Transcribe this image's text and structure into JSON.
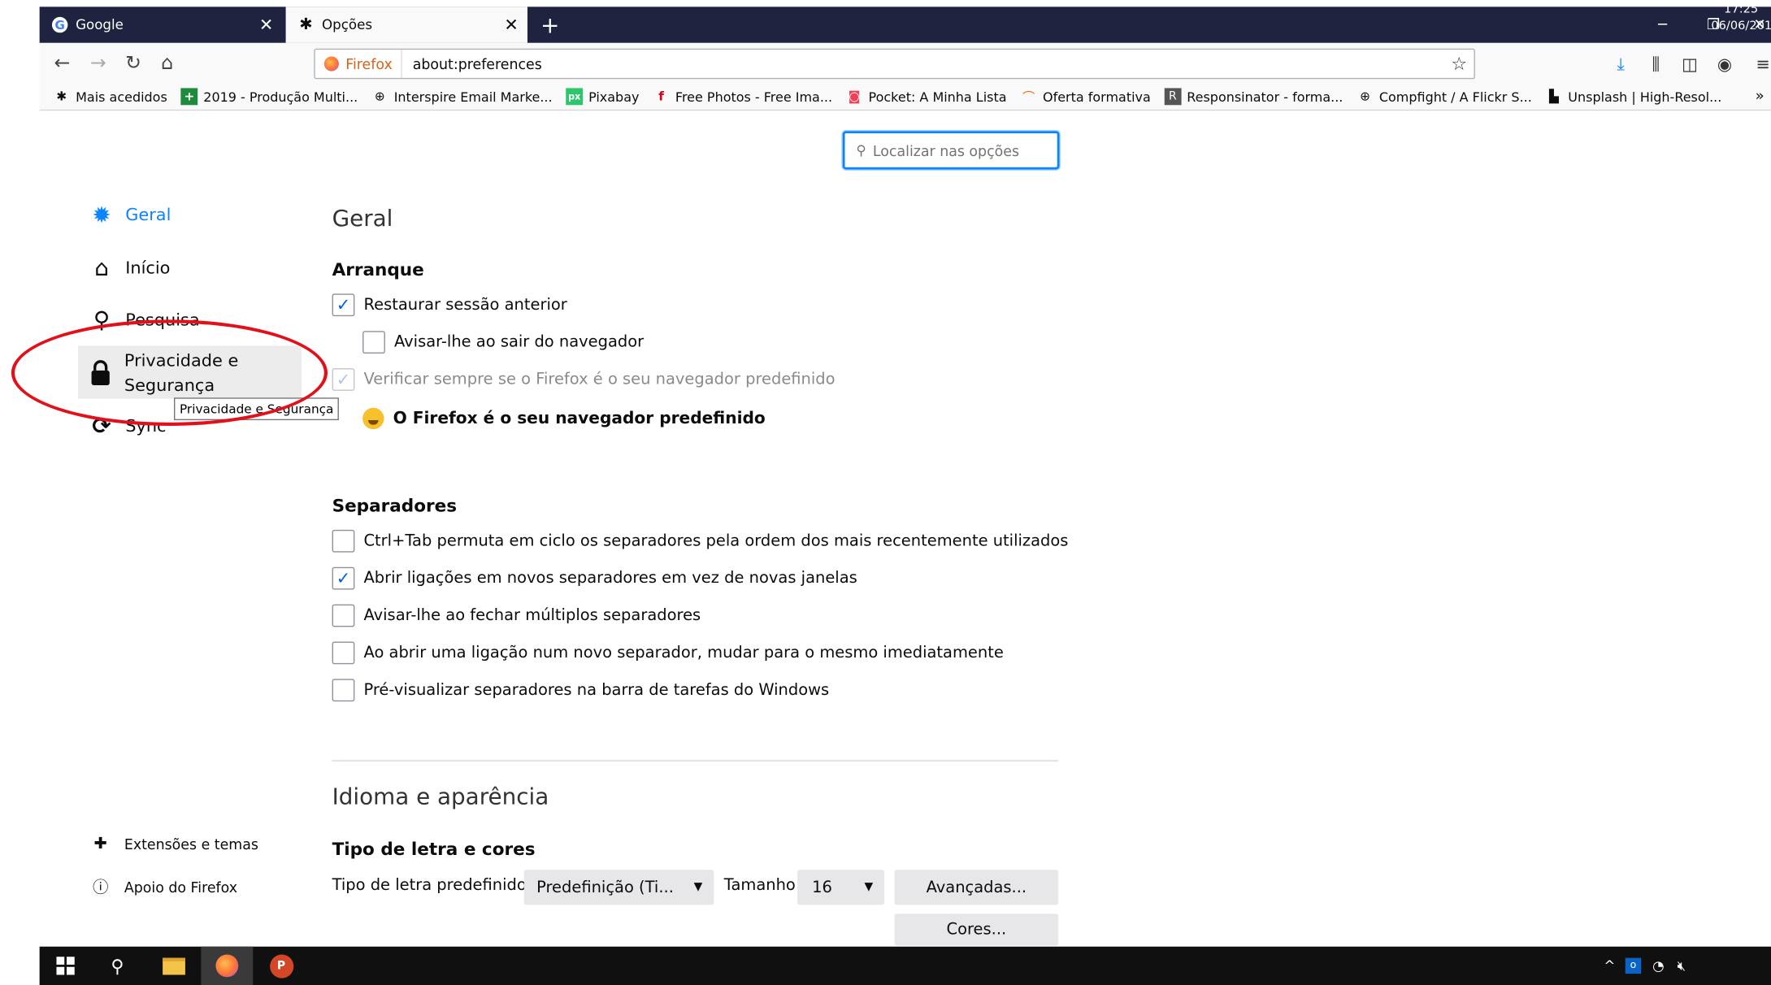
{
  "tabs": [
    {
      "label": "Google",
      "icon": "google-icon",
      "active": false
    },
    {
      "label": "Opções",
      "icon": "gear-icon",
      "active": true
    }
  ],
  "nav": {
    "identity": "Firefox",
    "url": "about:preferences"
  },
  "bookmarks": [
    {
      "label": "Mais acedidos",
      "icon": "gear-icon"
    },
    {
      "label": "2019 - Produção Multi...",
      "icon": "green-plus-icon"
    },
    {
      "label": "Interspire Email Marke...",
      "icon": "globe-icon"
    },
    {
      "label": "Pixabay",
      "icon": "pixabay-icon"
    },
    {
      "label": "Free Photos - Free Ima...",
      "icon": "freephotos-icon"
    },
    {
      "label": "Pocket: A Minha Lista",
      "icon": "pocket-icon"
    },
    {
      "label": "Oferta formativa",
      "icon": "oferta-icon"
    },
    {
      "label": "Responsinator - forma...",
      "icon": "responsinator-icon"
    },
    {
      "label": "Compfight / A Flickr S...",
      "icon": "globe-icon"
    },
    {
      "label": "Unsplash | High-Resol...",
      "icon": "unsplash-icon"
    }
  ],
  "search": {
    "placeholder": "Localizar nas opções"
  },
  "sidebar": {
    "items": [
      {
        "label": "Geral",
        "icon": "gear-icon",
        "selected": true
      },
      {
        "label": "Início",
        "icon": "home-icon"
      },
      {
        "label": "Pesquisa",
        "icon": "search-icon"
      },
      {
        "label": "Privacidade e Segurança",
        "label_line1": "Privacidade e",
        "label_line2": "Segurança",
        "icon": "lock-icon",
        "hovered": true
      },
      {
        "label": "Sync",
        "icon": "sync-icon"
      }
    ],
    "tooltip": "Privacidade e Segurança",
    "bottom": [
      {
        "label": "Extensões e temas",
        "icon": "puzzle-icon"
      },
      {
        "label": "Apoio do Firefox",
        "icon": "help-icon"
      }
    ]
  },
  "main": {
    "title": "Geral",
    "startup": {
      "heading": "Arranque",
      "restore": {
        "label": "Restaurar sessão anterior",
        "checked": true
      },
      "warn_quit": {
        "label": "Avisar-lhe ao sair do navegador",
        "checked": false
      },
      "check_default": {
        "label": "Verificar sempre se o Firefox é o seu navegador predefinido",
        "checked": true,
        "disabled": true
      },
      "default_msg": "O Firefox é o seu navegador predefinido"
    },
    "tabs_section": {
      "heading": "Separadores",
      "options": [
        {
          "label": "Ctrl+Tab permuta em ciclo os separadores pela ordem dos mais recentemente utilizados",
          "checked": false
        },
        {
          "label": "Abrir ligações em novos separadores em vez de novas janelas",
          "checked": true
        },
        {
          "label": "Avisar-lhe ao fechar múltiplos separadores",
          "checked": false
        },
        {
          "label": "Ao abrir uma ligação num novo separador, mudar para o mesmo imediatamente",
          "checked": false
        },
        {
          "label": "Pré-visualizar separadores na barra de tarefas do Windows",
          "checked": false
        }
      ]
    },
    "language": {
      "title": "Idioma e aparência",
      "fonts_heading": "Tipo de letra e cores",
      "default_font_label": "Tipo de letra predefinido",
      "default_font_value": "Predefinição (Ti...",
      "size_label": "Tamanho",
      "size_value": "16",
      "advanced_button": "Avançadas...",
      "colors_button": "Cores..."
    }
  },
  "taskbar": {
    "time": "17:25",
    "date": "06/06/201"
  },
  "colors": {
    "accent": "#0a84ff",
    "annotation": "#e3101a",
    "tabstrip": "#1f2340"
  }
}
